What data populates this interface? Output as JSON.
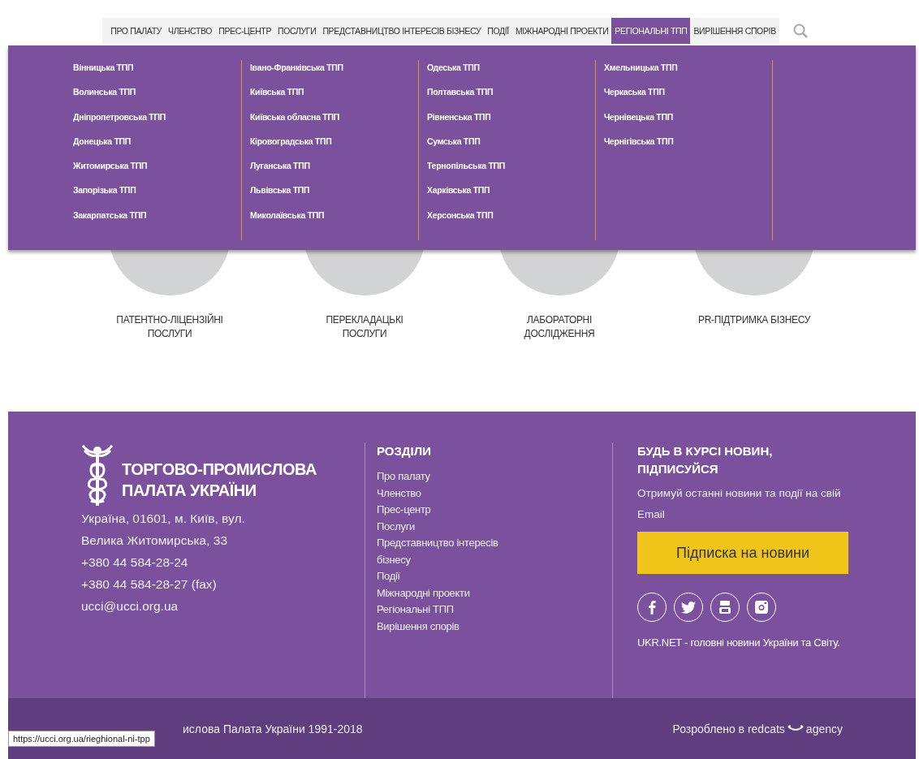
{
  "nav": {
    "items": [
      {
        "label": "ПРО ПАЛАТУ",
        "selected": false
      },
      {
        "label": "ЧЛЕНСТВО",
        "selected": false
      },
      {
        "label": "ПРЕС-ЦЕНТР",
        "selected": false
      },
      {
        "label": "ПОСЛУГИ",
        "selected": false
      },
      {
        "label": "ПРЕДСТАВНИЦТВО ІНТЕРЕСІВ БІЗНЕСУ",
        "selected": false
      },
      {
        "label": "ПОДІЇ",
        "selected": false
      },
      {
        "label": "МІЖНАРОДНІ ПРОЕКТИ",
        "selected": false
      },
      {
        "label": "РЕГІОНАЛЬНІ ТПП",
        "selected": true
      },
      {
        "label": "ВИРІШЕННЯ СПОРІВ",
        "selected": false
      }
    ]
  },
  "dropdown": {
    "columns": [
      [
        "Вінницька ТПП",
        "Волинська ТПП",
        "Дніпропетровська ТПП",
        "Донецька ТПП",
        "Житомирська ТПП",
        "Запорізька ТПП",
        "Закарпатська ТПП"
      ],
      [
        "Івано-Франківська ТПП",
        "Київська ТПП",
        "Київська обласна ТПП",
        "Кіровоградська ТПП",
        "Луганська ТПП",
        "Львівська ТПП",
        "Миколаївська ТПП"
      ],
      [
        "Одеська ТПП",
        "Полтавська ТПП",
        "Рівненська ТПП",
        "Сумська ТПП",
        "Тернопільська ТПП",
        "Харківська ТПП",
        "Херсонська ТПП"
      ],
      [
        "Хмельницька ТПП",
        "Черкаська ТПП",
        "Чернівецька ТПП",
        "Чернігівська ТПП"
      ]
    ]
  },
  "services": [
    {
      "label": "ПАТЕНТНО-ЛІЦЕНЗІЙНІ ПОСЛУГИ"
    },
    {
      "label": "ПЕРЕКЛАДАЦЬКІ ПОСЛУГИ"
    },
    {
      "label": "ЛАБОРАТОРНІ ДОСЛІДЖЕННЯ"
    },
    {
      "label": "PR-ПІДТРИМКА БІЗНЕСУ"
    }
  ],
  "footer": {
    "brand": [
      "ТОРГОВО-ПРОМИСЛОВА",
      "ПАЛАТА УКРАЇНИ"
    ],
    "contacts": [
      "Україна, 01601, м. Київ, вул.",
      "Велика Житомирська, 33",
      "+380 44 584-28-24",
      "+380 44 584-28-27 (fax)",
      "ucci@ucci.org.ua"
    ],
    "sections_title": "РОЗДІЛИ",
    "links": [
      "Про палату",
      "Членство",
      "Прес-центр",
      "Послуги",
      "Представництво інтересів бізнесу",
      "Події",
      "Міжнародні проекти",
      "Регіональні ТПП",
      "Вирішення спорів"
    ],
    "subscribe_title": "БУДЬ В КУРСІ НОВИН, ПІДПИСУЙСЯ",
    "subscribe_text": "Отримуй останні новини та події на свій Email",
    "subscribe_button": "Підписка на новини",
    "social": [
      {
        "kind": "facebook"
      },
      {
        "kind": "twitter"
      },
      {
        "kind": "youtube"
      },
      {
        "kind": "instagram"
      }
    ],
    "ukrnet": "UKR.NET - головні новини України та Світу."
  },
  "bottom": {
    "copyright": "ислова Палата України 1991-2018",
    "credit": "Розроблено в redcats",
    "credit_suffix": "agency"
  },
  "status_url": "https://ucci.org.ua/rieghional-ni-tpp"
}
